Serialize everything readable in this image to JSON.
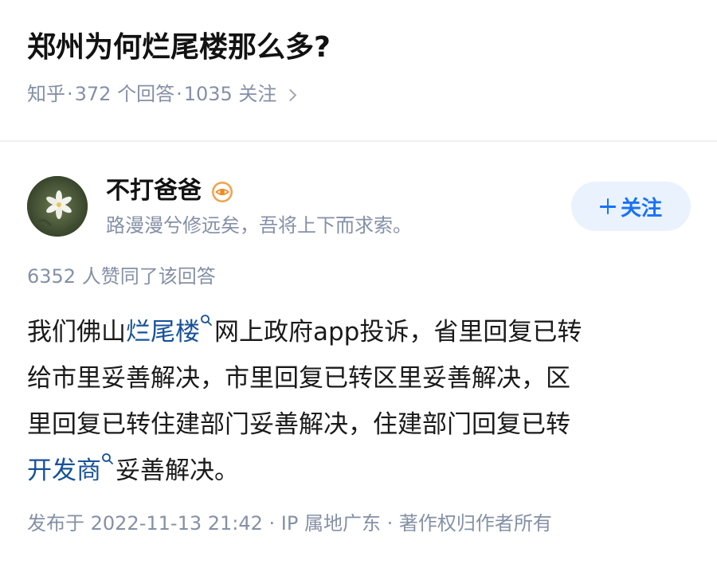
{
  "question": {
    "title": "郑州为何烂尾楼那么多?",
    "source": "知乎",
    "answers": "372 个回答",
    "followers": "1035 关注",
    "separator": "·"
  },
  "author": {
    "name": "不打爸爸",
    "bio": "路漫漫兮修远矣，吾将上下而求索。",
    "follow_label": "关注",
    "badge_icon": "eye-badge-icon",
    "avatar_icon": "flower-avatar"
  },
  "answer": {
    "vote_text": "6352 人赞同了该回答",
    "lines": [
      {
        "pre": "我们佛山",
        "link": "烂尾楼",
        "post": "网上政府app投诉，省里回复已转"
      },
      {
        "text": "给市里妥善解决，市里回复已转区里妥善解决，区"
      },
      {
        "text": "里回复已转住建部门妥善解决，住建部门回复已转"
      },
      {
        "pre": "",
        "link": "开发商",
        "post": "妥善解决。"
      }
    ],
    "footer": "发布于 2022-11-13 21:42 · IP 属地广东 · 著作权归作者所有"
  },
  "colors": {
    "link": "#175199",
    "accent": "#1772f6",
    "meta": "#8590a6",
    "follow_bg": "#eaf2fd"
  }
}
